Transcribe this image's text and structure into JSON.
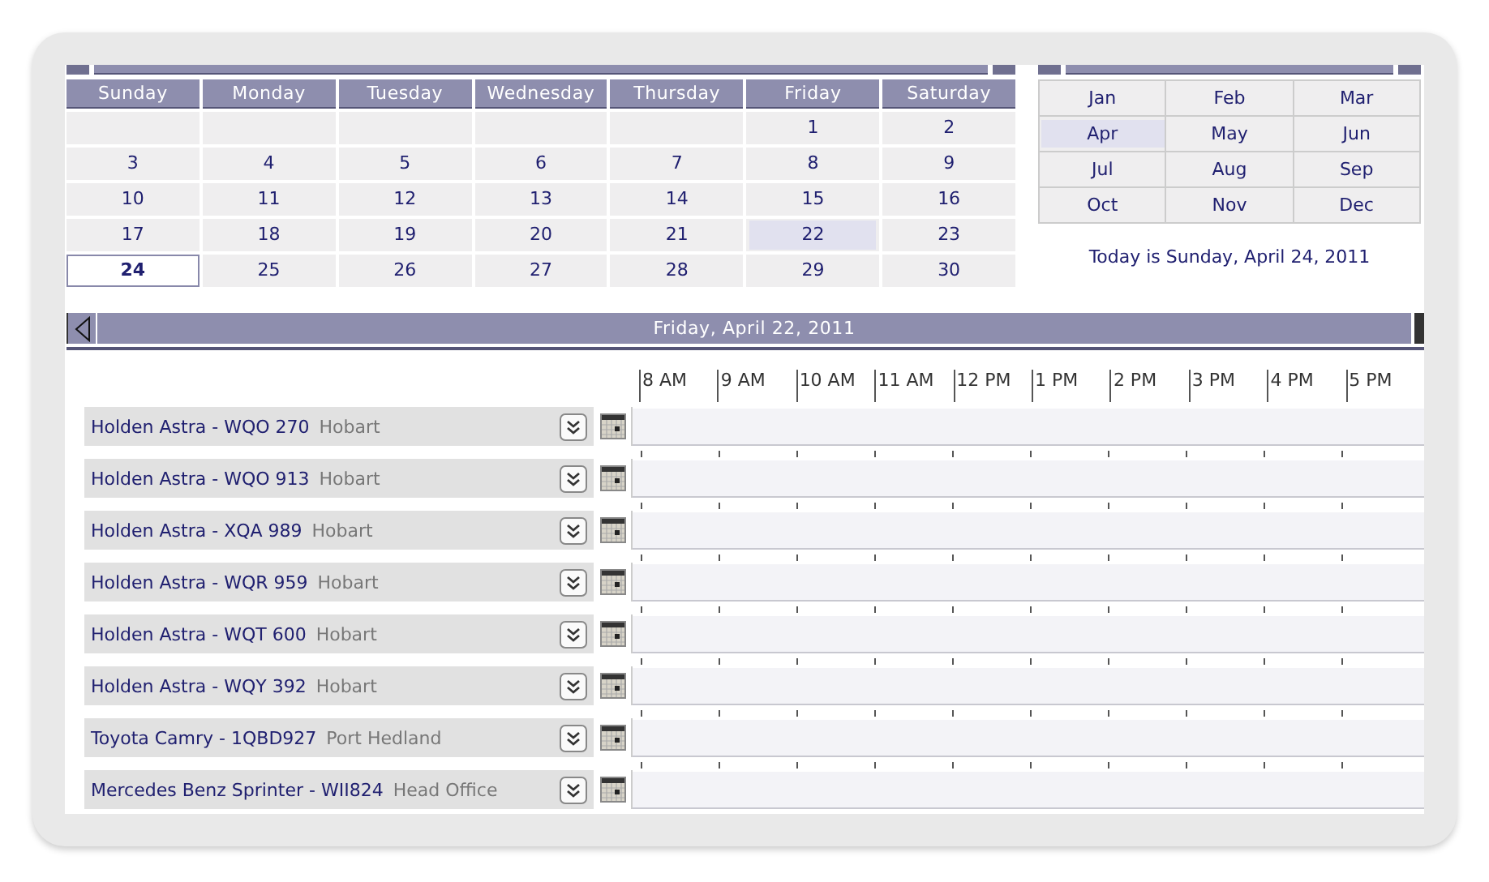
{
  "month_calendar": {
    "weekdays": [
      "Sunday",
      "Monday",
      "Tuesday",
      "Wednesday",
      "Thursday",
      "Friday",
      "Saturday"
    ],
    "weeks": [
      [
        {
          "day": "1",
          "selected": false,
          "today": false
        },
        {
          "day": "2",
          "selected": false,
          "today": false
        }
      ],
      [
        {
          "day": "3",
          "selected": false,
          "today": false
        },
        {
          "day": "4",
          "selected": false,
          "today": false
        },
        {
          "day": "5",
          "selected": false,
          "today": false
        },
        {
          "day": "6",
          "selected": false,
          "today": false
        },
        {
          "day": "7",
          "selected": false,
          "today": false
        },
        {
          "day": "8",
          "selected": false,
          "today": false
        },
        {
          "day": "9",
          "selected": false,
          "today": false
        }
      ],
      [
        {
          "day": "10",
          "selected": false,
          "today": false
        },
        {
          "day": "11",
          "selected": false,
          "today": false
        },
        {
          "day": "12",
          "selected": false,
          "today": false
        },
        {
          "day": "13",
          "selected": false,
          "today": false
        },
        {
          "day": "14",
          "selected": false,
          "today": false
        },
        {
          "day": "15",
          "selected": false,
          "today": false
        },
        {
          "day": "16",
          "selected": false,
          "today": false
        }
      ],
      [
        {
          "day": "17",
          "selected": false,
          "today": false
        },
        {
          "day": "18",
          "selected": false,
          "today": false
        },
        {
          "day": "19",
          "selected": false,
          "today": false
        },
        {
          "day": "20",
          "selected": false,
          "today": false
        },
        {
          "day": "21",
          "selected": false,
          "today": false
        },
        {
          "day": "22",
          "selected": true,
          "today": false
        },
        {
          "day": "23",
          "selected": false,
          "today": false
        }
      ],
      [
        {
          "day": "24",
          "selected": false,
          "today": true
        },
        {
          "day": "25",
          "selected": false,
          "today": false
        },
        {
          "day": "26",
          "selected": false,
          "today": false
        },
        {
          "day": "27",
          "selected": false,
          "today": false
        },
        {
          "day": "28",
          "selected": false,
          "today": false
        },
        {
          "day": "29",
          "selected": false,
          "today": false
        },
        {
          "day": "30",
          "selected": false,
          "today": false
        }
      ]
    ]
  },
  "month_picker": {
    "months": [
      {
        "label": "Jan",
        "selected": false
      },
      {
        "label": "Feb",
        "selected": false
      },
      {
        "label": "Mar",
        "selected": false
      },
      {
        "label": "Apr",
        "selected": true
      },
      {
        "label": "May",
        "selected": false
      },
      {
        "label": "Jun",
        "selected": false
      },
      {
        "label": "Jul",
        "selected": false
      },
      {
        "label": "Aug",
        "selected": false
      },
      {
        "label": "Sep",
        "selected": false
      },
      {
        "label": "Oct",
        "selected": false
      },
      {
        "label": "Nov",
        "selected": false
      },
      {
        "label": "Dec",
        "selected": false
      }
    ],
    "today_text": "Today is Sunday, April 24, 2011"
  },
  "day_view": {
    "title": "Friday, April 22, 2011",
    "hours": [
      "8 AM",
      "9 AM",
      "10 AM",
      "11 AM",
      "12 PM",
      "1 PM",
      "2 PM",
      "3 PM",
      "4 PM",
      "5 PM"
    ],
    "resources": [
      {
        "name": "Holden Astra - WQO 270",
        "location": "Hobart"
      },
      {
        "name": "Holden Astra - WQO 913",
        "location": "Hobart"
      },
      {
        "name": "Holden Astra - XQA 989",
        "location": "Hobart"
      },
      {
        "name": "Holden Astra - WQR 959",
        "location": "Hobart"
      },
      {
        "name": "Holden Astra - WQT 600",
        "location": "Hobart"
      },
      {
        "name": "Holden Astra - WQY 392",
        "location": "Hobart"
      },
      {
        "name": "Toyota Camry - 1QBD927",
        "location": "Port Hedland"
      },
      {
        "name": "Mercedes Benz Sprinter - WII824",
        "location": "Head Office"
      }
    ]
  }
}
